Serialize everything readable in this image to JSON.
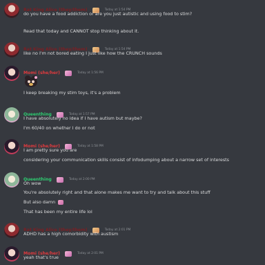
{
  "colors": {
    "background": "#36393f",
    "text": "#dcddde",
    "timestamp": "#8e9297",
    "alice_name": "#7b1f24",
    "momi_name": "#e03a3e",
    "queen_name": "#2ecc71"
  },
  "messages": [
    {
      "author": "Rat King Alice (they/them)",
      "timestamp": "Today at 1:54 PM",
      "lines": [
        "do you have a food addiction or are you just autistic and using food to stim?",
        "Read that today and CANNOT stop thinking about it."
      ]
    },
    {
      "author": "Rat King Alice (they/them)",
      "timestamp": "Today at 1:54 PM",
      "lines": [
        "like no I'm not bored eating I just like how the CRUNCH sounds"
      ]
    },
    {
      "author": "Momi (she/her)",
      "timestamp": "Today at 1:56 PM",
      "sticker": "plush-sticker",
      "lines": [
        "I keep breaking my stim toys, it's a problem"
      ]
    },
    {
      "author": "Queenthing",
      "timestamp": "Today at 1:57 PM",
      "lines": [
        "I have absolutely no idea if I have autism but maybe?",
        "I'm 60/40 on whether I do or not"
      ]
    },
    {
      "author": "Momi (she/her)",
      "timestamp": "Today at 1:58 PM",
      "lines": [
        "I am pretty sure you are",
        "considering your communication skills consist of infodumping about a narrow set of interests"
      ]
    },
    {
      "author": "Queenthing",
      "timestamp": "Today at 2:00 PM",
      "lines": [
        "Oh wow",
        "You're absolutely right and that alone makes me want to try and talk about this stuff",
        "But also damn",
        "That has been my entire life lol"
      ]
    },
    {
      "author": "Rat King Alice (they/them)",
      "timestamp": "Today at 2:01 PM",
      "lines": [
        "ADHD has a high comorbidity with austism"
      ]
    },
    {
      "author": "Momi (she/her)",
      "timestamp": "Today at 2:01 PM",
      "lines": [
        "yeah that's true"
      ]
    }
  ]
}
